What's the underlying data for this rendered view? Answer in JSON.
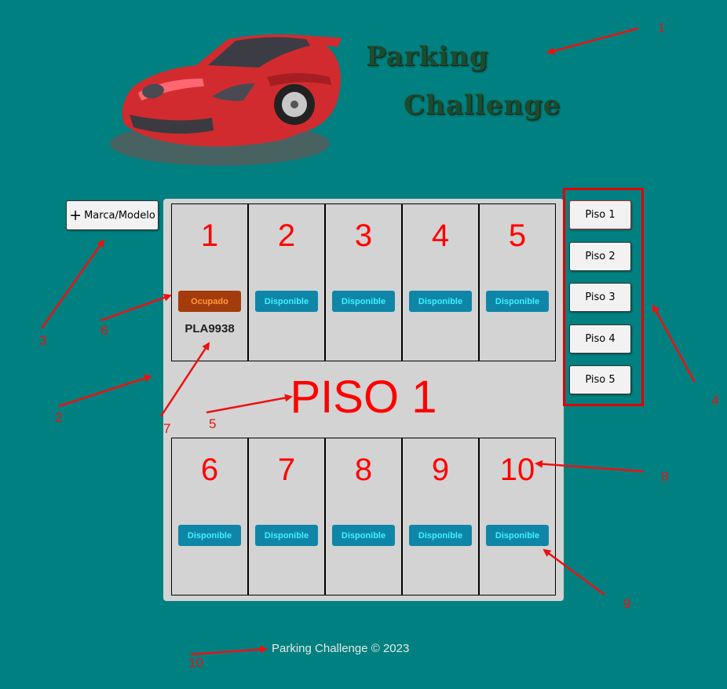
{
  "header": {
    "title_line1": "Parking",
    "title_line2": "Challenge",
    "logo_icon": "sports-car-illustration"
  },
  "add_button": {
    "icon": "plus-icon",
    "icon_glyph": "+",
    "label": "Marca/Modelo"
  },
  "floor_title": "PISO 1",
  "spots_top": [
    {
      "number": "1",
      "status": "Ocupado",
      "plate": "PLA9938"
    },
    {
      "number": "2",
      "status": "Disponible"
    },
    {
      "number": "3",
      "status": "Disponible"
    },
    {
      "number": "4",
      "status": "Disponible"
    },
    {
      "number": "5",
      "status": "Disponible"
    }
  ],
  "spots_bottom": [
    {
      "number": "6",
      "status": "Disponible"
    },
    {
      "number": "7",
      "status": "Disponible"
    },
    {
      "number": "8",
      "status": "Disponible"
    },
    {
      "number": "9",
      "status": "Disponible"
    },
    {
      "number": "10",
      "status": "Disponible"
    }
  ],
  "floors": [
    "Piso 1",
    "Piso 2",
    "Piso 3",
    "Piso 4",
    "Piso 5"
  ],
  "footer": "Parking Challenge © 2023",
  "annotations": [
    "1",
    "2",
    "3",
    "4",
    "5",
    "6",
    "7",
    "8",
    "9",
    "10"
  ],
  "colors": {
    "background": "#008080",
    "board": "#d3d3d3",
    "accent_red": "#ff0000",
    "free_badge": "#0f86a8",
    "busy_badge": "#a33b0c"
  }
}
